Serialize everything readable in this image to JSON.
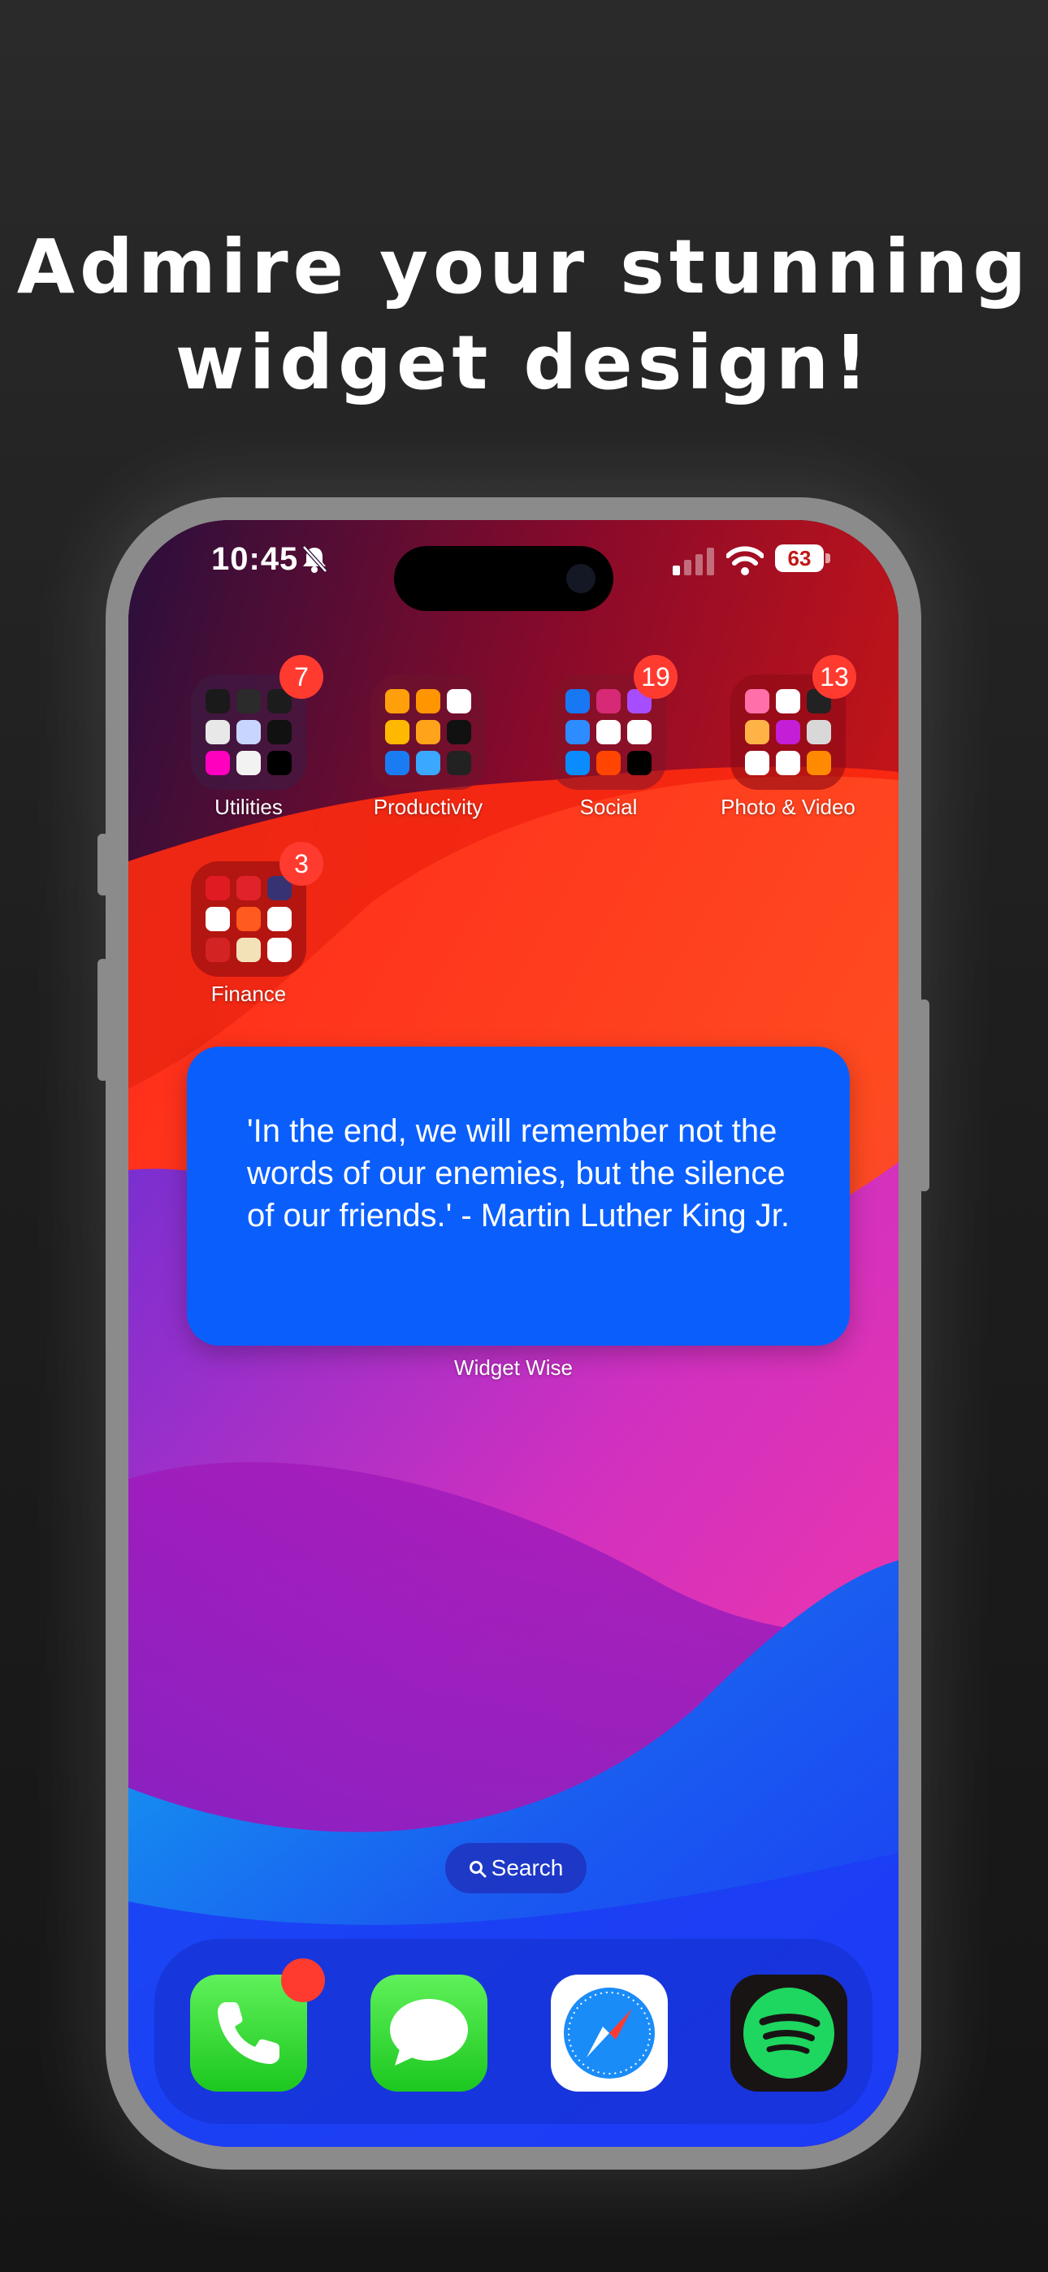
{
  "headline": {
    "line1": "Admire your stunning",
    "line2": "widget design!"
  },
  "status_bar": {
    "time": "10:45",
    "battery": "63"
  },
  "folders": [
    {
      "label": "Utilities",
      "badge": "7"
    },
    {
      "label": "Productivity",
      "badge": ""
    },
    {
      "label": "Social",
      "badge": "19"
    },
    {
      "label": "Photo & Video",
      "badge": "13"
    },
    {
      "label": "Finance",
      "badge": "3"
    }
  ],
  "widget": {
    "quote": "'In the end, we will remember not the words of our enemies, but the silence of our friends.' - Martin Luther King Jr.",
    "caption": "Widget Wise"
  },
  "search": {
    "label": "Search"
  },
  "dock": [
    "phone-icon",
    "messages-icon",
    "safari-icon",
    "spotify-icon"
  ],
  "colors": {
    "widget_bg": "#0a5ffc",
    "badge": "#ff3b30",
    "phone_frame": "#8b8b8b",
    "page_bg": "#222222"
  }
}
